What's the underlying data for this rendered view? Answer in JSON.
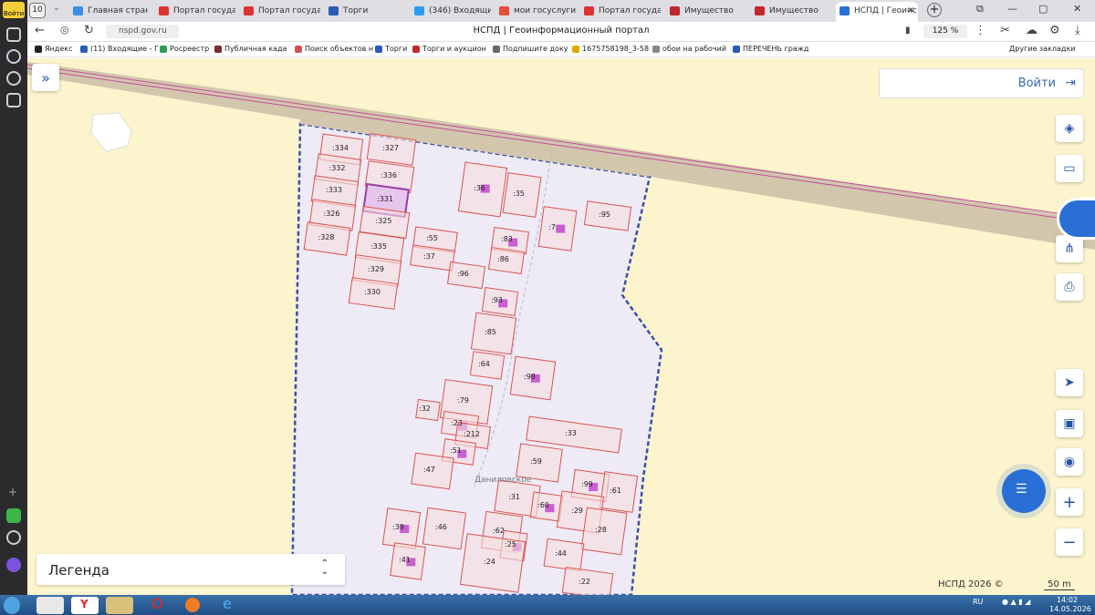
{
  "browser": {
    "tab_count": "10",
    "tabs": [
      {
        "label": "Главная страниц",
        "color": "#3a8ee6"
      },
      {
        "label": "Портал государс",
        "color": "#d33"
      },
      {
        "label": "Портал государс",
        "color": "#d33"
      },
      {
        "label": "Торги",
        "color": "#2a5bb7"
      },
      {
        "label": "(346) Входящие",
        "color": "#2a9df4"
      },
      {
        "label": "мои госуслуги в",
        "color": "#e74c3c"
      },
      {
        "label": "Портал государс",
        "color": "#d33"
      },
      {
        "label": "Имущество",
        "color": "#c0282d"
      },
      {
        "label": "Имущество",
        "color": "#c0282d"
      },
      {
        "label": "НСПД | Геоинс",
        "color": "#2a6fd6"
      }
    ],
    "url": "nspd.gov.ru",
    "page_title": "НСПД | Геоинформационный портал",
    "zoom": "125 %",
    "sidebar_login": "Войти"
  },
  "bookmarks": [
    {
      "label": "Яндекс",
      "color": "#222"
    },
    {
      "label": "(11) Входящие - Г",
      "color": "#2a5bb7"
    },
    {
      "label": "Росреестр",
      "color": "#2e9b59"
    },
    {
      "label": "Публичная када",
      "color": "#7a2d2d"
    },
    {
      "label": "Поиск объектов н",
      "color": "#c55"
    },
    {
      "label": "Торги",
      "color": "#2a5bb7"
    },
    {
      "label": "Торги и аукцион",
      "color": "#c0282d"
    },
    {
      "label": "Подпишите доку",
      "color": "#666"
    },
    {
      "label": "1675758198_3-58",
      "color": "#e0a800"
    },
    {
      "label": "обои на рабочий",
      "color": "#888"
    },
    {
      "label": "ПЕРЕЧЕНЬ гражд",
      "color": "#2a5bb7"
    }
  ],
  "bookmarks_other": "Другие закладки",
  "map": {
    "login_label": "Войти",
    "legend_label": "Легенда",
    "settlement_label": "Даниловское",
    "attribution": "НСПД 2026 ©",
    "scale_label": "50 m",
    "colors": {
      "background": "#fbf4cc",
      "settlement_fill": "#eeebf7",
      "boundary": "#3a4fa8",
      "parcel_stroke": "#d9534f",
      "parcel_fill": "#f7dede",
      "building": "#c95fd0",
      "road": "#d2c6ad",
      "selected": "#9b3aa8"
    },
    "parcels": [
      ":334",
      ":327",
      ":332",
      ":336",
      ":333",
      ":331",
      ":326",
      ":325",
      ":328",
      ":335",
      ":329",
      ":330",
      ":36",
      ":35",
      ":95",
      ":7",
      ":55",
      ":37",
      ":83",
      ":86",
      ":96",
      ":93",
      ":85",
      ":64",
      ":98",
      ":79",
      ":32",
      ":23",
      ":33",
      ":212",
      ":51",
      ":47",
      ":59",
      ":99",
      ":61",
      ":31",
      ":60",
      ":29",
      ":28",
      ":39",
      ":46",
      ":62",
      ":25",
      ":24",
      ":44",
      ":41",
      ":22"
    ]
  },
  "taskbar": {
    "lang": "RU",
    "time": "14:02",
    "date": "14.05.2026"
  }
}
